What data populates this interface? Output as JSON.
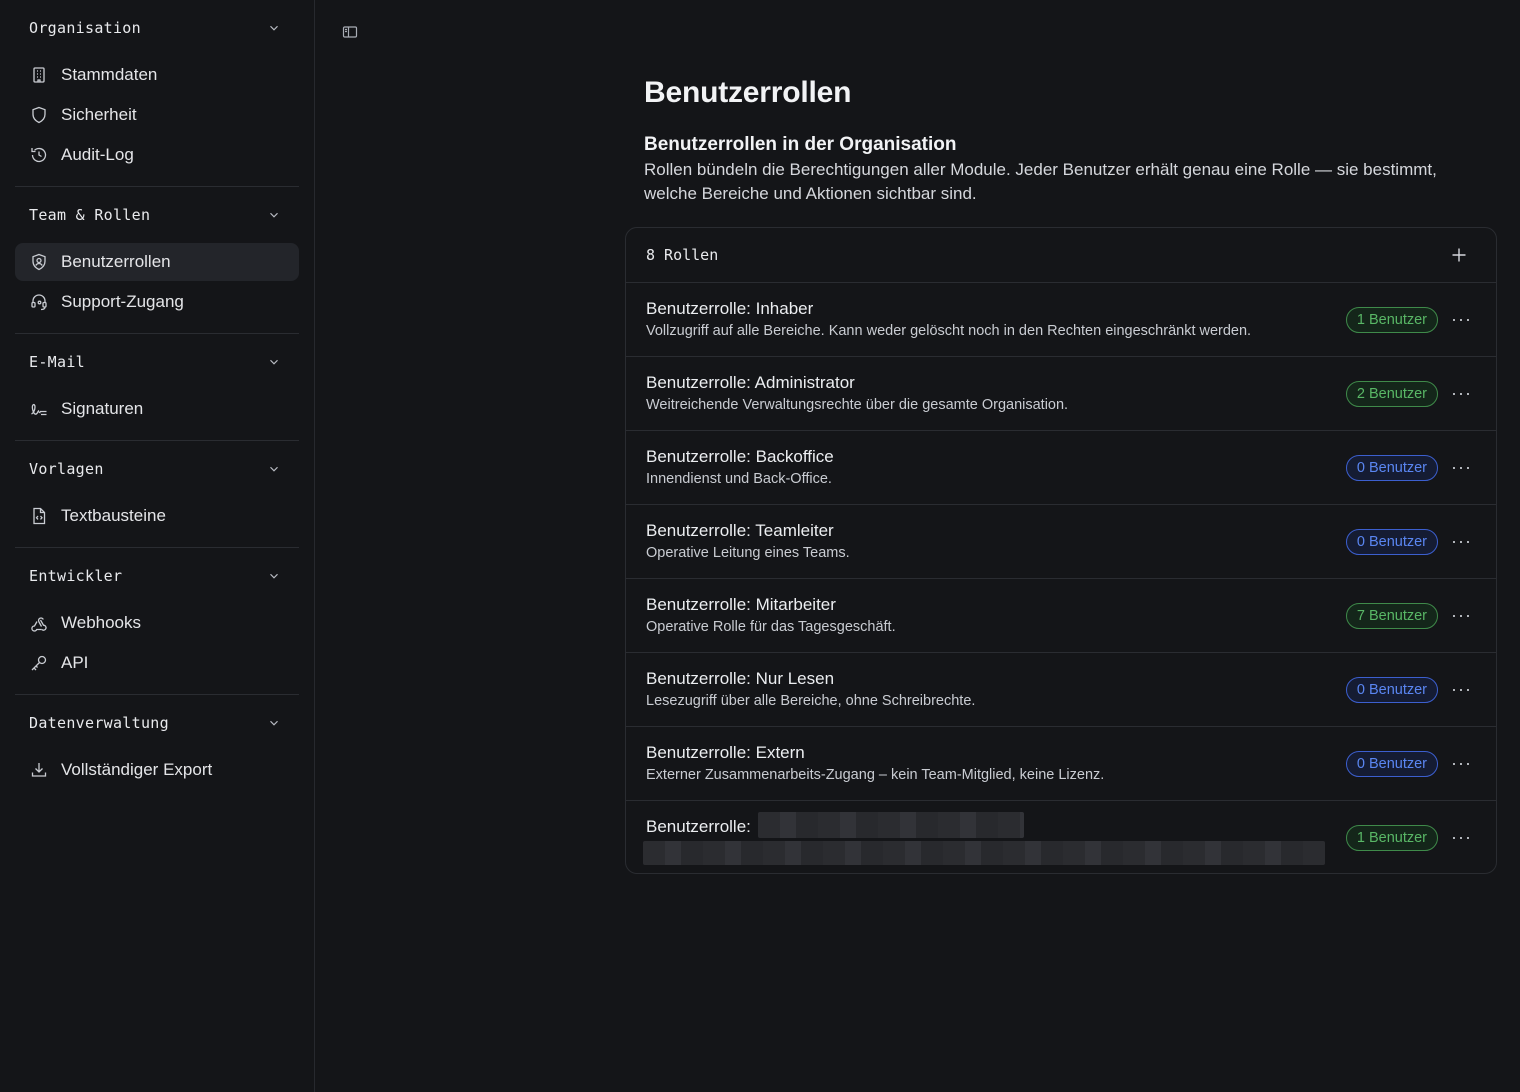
{
  "sidebar": {
    "groups": [
      {
        "label": "Organisation",
        "items": [
          {
            "label": "Stammdaten",
            "icon": "building-icon"
          },
          {
            "label": "Sicherheit",
            "icon": "shield-icon"
          },
          {
            "label": "Audit-Log",
            "icon": "history-icon"
          }
        ]
      },
      {
        "label": "Team & Rollen",
        "items": [
          {
            "label": "Benutzerrollen",
            "icon": "shield-user-icon",
            "active": true
          },
          {
            "label": "Support-Zugang",
            "icon": "headset-icon"
          }
        ]
      },
      {
        "label": "E-Mail",
        "items": [
          {
            "label": "Signaturen",
            "icon": "signature-icon"
          }
        ]
      },
      {
        "label": "Vorlagen",
        "items": [
          {
            "label": "Textbausteine",
            "icon": "file-code-icon"
          }
        ]
      },
      {
        "label": "Entwickler",
        "items": [
          {
            "label": "Webhooks",
            "icon": "webhook-icon"
          },
          {
            "label": "API",
            "icon": "key-icon"
          }
        ]
      },
      {
        "label": "Datenverwaltung",
        "items": [
          {
            "label": "Vollständiger Export",
            "icon": "download-icon"
          }
        ]
      }
    ]
  },
  "page": {
    "title": "Benutzerrollen",
    "section_title": "Benutzerrollen in der Organisation",
    "section_desc": "Rollen bündeln die Berechtigungen aller Module. Jeder Benutzer erhält genau eine Rolle — sie bestimmt, welche Bereiche und Aktionen sichtbar sind."
  },
  "roles_card": {
    "count_label": "8 Rollen",
    "roles": [
      {
        "title": "Benutzerrolle: Inhaber",
        "desc": "Vollzugriff auf alle Bereiche. Kann weder gelöscht noch in den Rechten eingeschränkt werden.",
        "badge": "1 Benutzer",
        "badge_color": "green"
      },
      {
        "title": "Benutzerrolle: Administrator",
        "desc": "Weitreichende Verwaltungsrechte über die gesamte Organisation.",
        "badge": "2 Benutzer",
        "badge_color": "green"
      },
      {
        "title": "Benutzerrolle: Backoffice",
        "desc": "Innendienst und Back-Office.",
        "badge": "0 Benutzer",
        "badge_color": "blue"
      },
      {
        "title": "Benutzerrolle: Teamleiter",
        "desc": "Operative Leitung eines Teams.",
        "badge": "0 Benutzer",
        "badge_color": "blue"
      },
      {
        "title": "Benutzerrolle: Mitarbeiter",
        "desc": "Operative Rolle für das Tagesgeschäft.",
        "badge": "7 Benutzer",
        "badge_color": "green"
      },
      {
        "title": "Benutzerrolle: Nur Lesen",
        "desc": "Lesezugriff über alle Bereiche, ohne Schreibrechte.",
        "badge": "0 Benutzer",
        "badge_color": "blue"
      },
      {
        "title": "Benutzerrolle: Extern",
        "desc": "Externer Zusammenarbeits-Zugang – kein Team-Mitglied, keine Lizenz.",
        "badge": "0 Benutzer",
        "badge_color": "blue"
      },
      {
        "title": "Benutzerrolle:",
        "desc": "",
        "badge": "1 Benutzer",
        "badge_color": "green",
        "redacted": true
      }
    ],
    "more_glyph": "···"
  },
  "colors": {
    "background": "#141518",
    "badge_green": "#59b766",
    "badge_blue": "#5a86f2"
  }
}
